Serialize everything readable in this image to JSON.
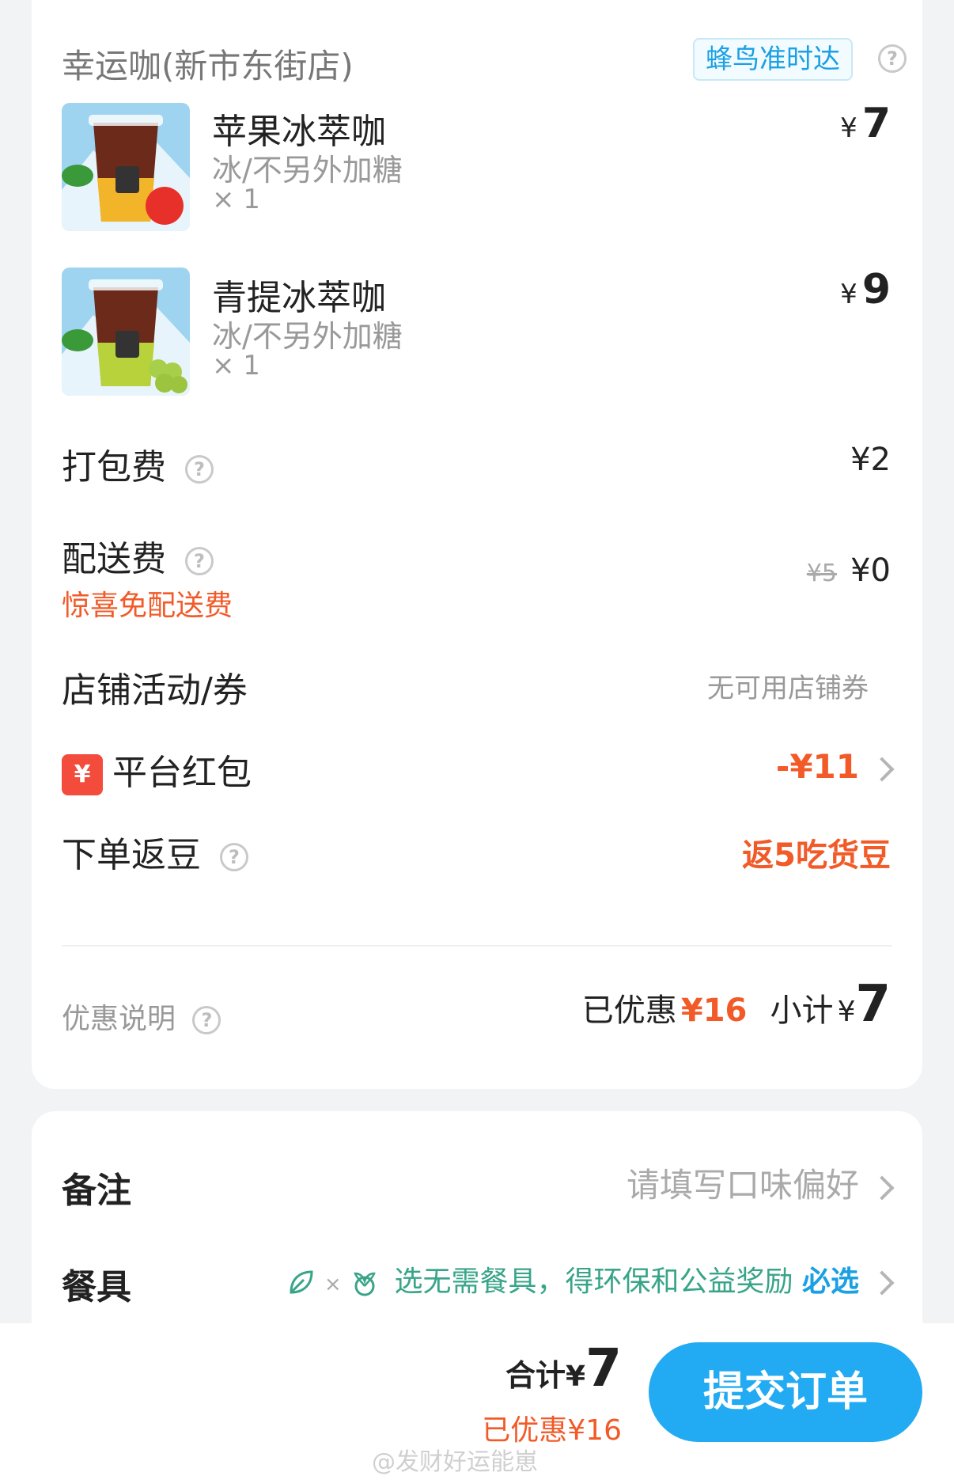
{
  "store": {
    "name": "幸运咖(新市东街店)",
    "delivery_badge": "蜂鸟准时达"
  },
  "items": [
    {
      "name": "苹果冰萃咖",
      "spec": "冰/不另外加糖",
      "qty": "× 1",
      "currency": "¥",
      "price": "7",
      "fruit": "apple"
    },
    {
      "name": "青提冰萃咖",
      "spec": "冰/不另外加糖",
      "qty": "× 1",
      "currency": "¥",
      "price": "9",
      "fruit": "grape"
    }
  ],
  "fees": {
    "packing_label": "打包费",
    "packing_value": "¥2",
    "delivery_label": "配送费",
    "delivery_promo": "惊喜免配送费",
    "delivery_original": "¥5",
    "delivery_value": "¥0"
  },
  "store_coupon": {
    "label": "店铺活动/券",
    "value": "无可用店铺券"
  },
  "red_packet": {
    "icon": "¥",
    "label": "平台红包",
    "value": "-¥11"
  },
  "beans": {
    "label": "下单返豆",
    "value": "返5吃货豆"
  },
  "summary": {
    "explain_label": "优惠说明",
    "discount_label": "已优惠",
    "discount_value": "¥16",
    "subtotal_label": "小计",
    "subtotal_currency": "¥",
    "subtotal_value": "7"
  },
  "remark": {
    "label": "备注",
    "placeholder": "请填写口味偏好"
  },
  "tableware": {
    "label": "餐具",
    "text": "选无需餐具，得环保和公益奖励",
    "required": "必选",
    "icons": [
      "leaf-icon",
      "sprout-icon"
    ]
  },
  "footer": {
    "total_label": "合计",
    "total_currency": "¥",
    "total_value": "7",
    "discount_text": "已优惠¥16",
    "submit_label": "提交订单"
  },
  "watermark": "@发财好运能崽",
  "colors": {
    "accent_blue": "#22aaf2",
    "discount_red": "#f25a28",
    "eco_green": "#38a488"
  }
}
